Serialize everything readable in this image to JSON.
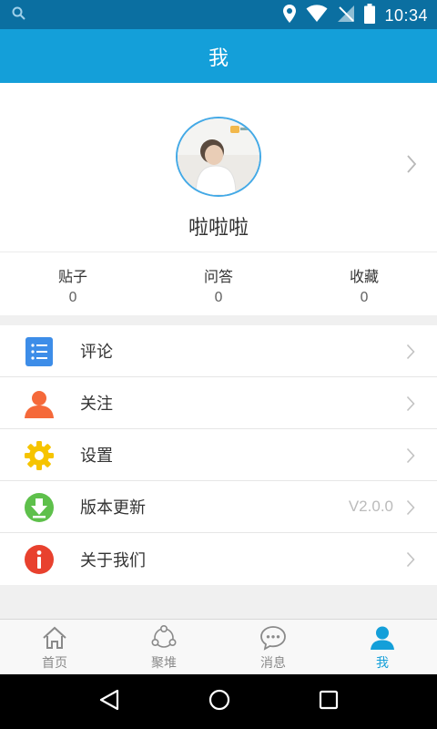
{
  "status_bar": {
    "time": "10:34",
    "icons": [
      "search-icon",
      "location-icon",
      "wifi-icon",
      "no-signal-icon",
      "battery-icon"
    ]
  },
  "header": {
    "title": "我"
  },
  "profile": {
    "username": "啦啦啦",
    "avatar": "avatar"
  },
  "stats": [
    {
      "label": "贴子",
      "value": "0"
    },
    {
      "label": "问答",
      "value": "0"
    },
    {
      "label": "收藏",
      "value": "0"
    }
  ],
  "menu": [
    {
      "label": "评论",
      "icon": "list-icon",
      "value": ""
    },
    {
      "label": "关注",
      "icon": "person-icon",
      "value": ""
    },
    {
      "label": "设置",
      "icon": "gear-icon",
      "value": ""
    },
    {
      "label": "版本更新",
      "icon": "download-icon",
      "value": "V2.0.0"
    },
    {
      "label": "关于我们",
      "icon": "info-icon",
      "value": ""
    }
  ],
  "tabs": [
    {
      "label": "首页",
      "icon": "home-icon",
      "active": false
    },
    {
      "label": "聚堆",
      "icon": "share-cluster-icon",
      "active": false
    },
    {
      "label": "消息",
      "icon": "chat-icon",
      "active": false
    },
    {
      "label": "我",
      "icon": "person-icon",
      "active": true
    }
  ],
  "colors": {
    "status_bar": "#0b6fa1",
    "header": "#149fd9",
    "accent": "#149fd9",
    "list_icon": "#3d8de8",
    "person_icon": "#f5693a",
    "gear_icon": "#f6c400",
    "download_icon": "#5ec04b",
    "info_icon": "#e8412e"
  }
}
